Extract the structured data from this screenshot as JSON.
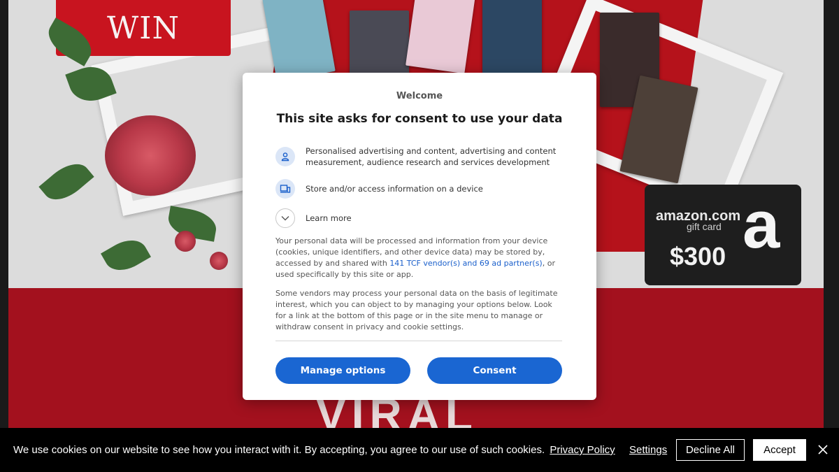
{
  "background": {
    "sign_text": "WIN",
    "giftcard": {
      "brand": "amazon.com",
      "sub": "gift card",
      "amount": "$300",
      "logo": "a"
    },
    "bottom_text": "VIRAL"
  },
  "consent_dialog": {
    "welcome": "Welcome",
    "title": "This site asks for consent to use your data",
    "purposes": [
      {
        "icon": "person-icon",
        "text": "Personalised advertising and content, advertising and content measurement, audience research and services development"
      },
      {
        "icon": "device-icon",
        "text": "Store and/or access information on a device"
      }
    ],
    "learn_more": "Learn more",
    "paragraph1_before": "Your personal data will be processed and information from your device (cookies, unique identifiers, and other device data) may be stored by, accessed by and shared with ",
    "paragraph1_link": "141 TCF vendor(s) and 69 ad partner(s)",
    "paragraph1_after": ", or used specifically by this site or app.",
    "paragraph2": "Some vendors may process your personal data on the basis of legitimate interest, which you can object to by managing your options below. Look for a link at the bottom of this page or in the site menu to manage or withdraw consent in privacy and cookie settings.",
    "manage_label": "Manage options",
    "consent_label": "Consent",
    "accent_color": "#1a66d2"
  },
  "cookie_bar": {
    "text": "We use cookies on our website to see how you interact with it. By accepting, you agree to our use of such cookies.",
    "privacy_link": "Privacy Policy",
    "settings_label": "Settings",
    "decline_label": "Decline All",
    "accept_label": "Accept"
  }
}
